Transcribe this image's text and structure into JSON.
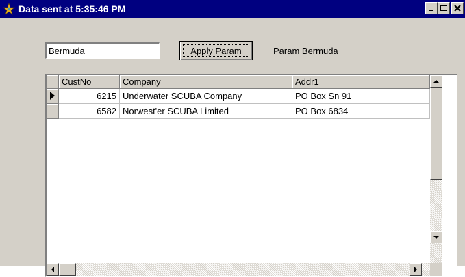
{
  "window": {
    "title": "Data sent at 5:35:46 PM",
    "title_bar_color": "#000080",
    "face_color": "#d4d0c8",
    "controls": [
      "minimize-icon",
      "maximize-icon",
      "close-icon"
    ]
  },
  "form": {
    "param_value": "Bermuda",
    "apply_label": "Apply Param",
    "param_label": "Param Bermuda"
  },
  "grid": {
    "columns": [
      "CustNo",
      "Company",
      "Addr1"
    ],
    "rows": [
      {
        "custno": "6215",
        "company": "Underwater SCUBA Company",
        "addr1": "PO Box Sn 91",
        "current": true
      },
      {
        "custno": "6582",
        "company": "Norwest'er SCUBA Limited",
        "addr1": "PO Box 6834",
        "current": false
      }
    ],
    "current_row_icon": "triangle-right-icon"
  }
}
